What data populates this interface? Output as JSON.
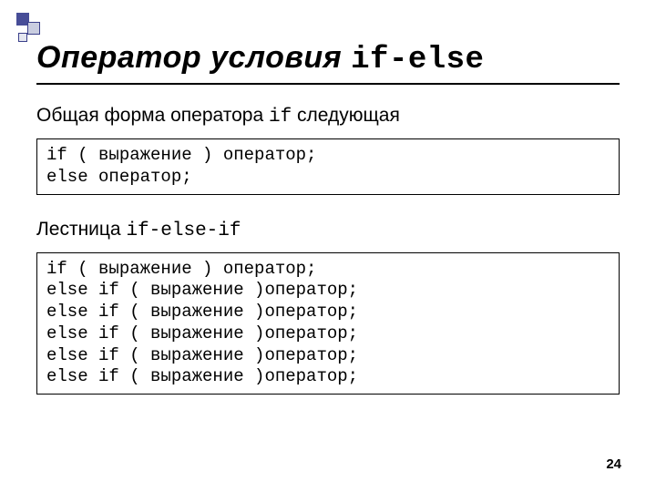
{
  "title_plain": "Оператор условия ",
  "title_mono": "if-else",
  "intro_pre": "Общая форма оператора ",
  "intro_mono": "if",
  "intro_post": " следующая",
  "code1": "if ( выражение ) оператор;\nelse оператор;",
  "section2_pre": "Лестница ",
  "section2_mono": "if-else-if",
  "code2": "if ( выражение ) оператор;\nelse if ( выражение )оператор;\nelse if ( выражение )оператор;\nelse if ( выражение )оператор;\nelse if ( выражение )оператор;\nelse if ( выражение )оператор;",
  "page_number": "24"
}
